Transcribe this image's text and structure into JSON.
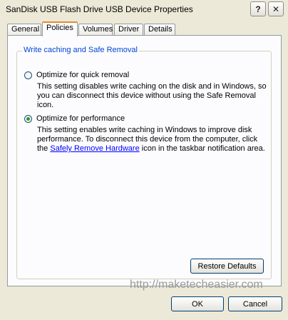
{
  "window": {
    "title": "SanDisk USB Flash Drive USB Device Properties",
    "help_button": "?",
    "close_button": "✕"
  },
  "tabs": [
    {
      "label": "General"
    },
    {
      "label": "Policies",
      "active": true
    },
    {
      "label": "Volumes"
    },
    {
      "label": "Driver"
    },
    {
      "label": "Details"
    }
  ],
  "group": {
    "legend": "Write caching and Safe Removal",
    "options": [
      {
        "label": "Optimize for quick removal",
        "checked": false,
        "description": "This setting disables write caching on the disk and in Windows, so you can disconnect this device without using the Safe Removal icon."
      },
      {
        "label": "Optimize for performance",
        "checked": true,
        "description_before": "This setting enables write caching in Windows to improve disk performance. To disconnect this device from the computer, click the ",
        "link": "Safely Remove Hardware",
        "description_after": " icon in the taskbar notification area."
      }
    ],
    "restore_button": "Restore Defaults"
  },
  "buttons": {
    "ok": "OK",
    "cancel": "Cancel"
  },
  "watermark": "http://maketecheasier.com",
  "colors": {
    "legend": "#0046d5",
    "active_tab_accent": "#e68b2c",
    "radio_dot": "#21a121",
    "link": "#0000ff"
  }
}
